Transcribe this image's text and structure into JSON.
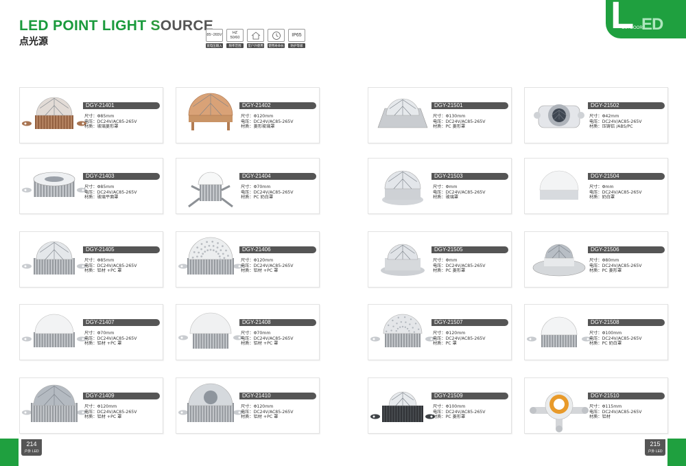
{
  "header": {
    "title_colored": [
      {
        "text": "LED POINT LIGHT ",
        "color": "#1a9a3c"
      },
      {
        "text": "S",
        "color": "#2c9a3e"
      },
      {
        "text": "OURCE",
        "color": "#555555"
      }
    ],
    "subtitle": "点光源",
    "specs": [
      {
        "lines": [
          "85~265V"
        ],
        "caption": "宽电压输入",
        "icon": "voltage-icon"
      },
      {
        "lines": [
          "HZ",
          "50/60"
        ],
        "caption": "频率范围",
        "icon": "frequency-icon"
      },
      {
        "lines": [
          ""
        ],
        "caption": "室户外使用",
        "icon": "house-icon"
      },
      {
        "lines": [
          ""
        ],
        "caption": "使用寿命长",
        "icon": "clock-icon"
      },
      {
        "lines": [
          "IP65"
        ],
        "caption": "防护等级",
        "icon": "ip-icon"
      }
    ]
  },
  "corner": {
    "big": "L",
    "ed": "ED",
    "tag": "OUTDOOR"
  },
  "labels": {
    "size": "尺寸：",
    "voltage": "电压：",
    "material": "材质："
  },
  "products": [
    {
      "model": "DGY-21401",
      "size": "Φ85mm",
      "voltage": "DC24V/AC85-265V",
      "material": "玻璃菱形罩",
      "lamp": "crystal-copper"
    },
    {
      "model": "DGY-21402",
      "size": "Φ120mm",
      "voltage": "DC24V/AC85-265V",
      "material": "菱形玻璃罩",
      "lamp": "gold"
    },
    {
      "model": "DGY-21501",
      "size": "Φ130mm",
      "voltage": "DC24V/AC85-265V",
      "material": "PC 菱形罩",
      "lamp": "hex-silver"
    },
    {
      "model": "DGY-21502",
      "size": "Φ42mm",
      "voltage": "DC24V/AC85-265V",
      "material": "压铸铝 /ABS/PC",
      "lamp": "small-crystal"
    },
    {
      "model": "DGY-21403",
      "size": "Φ85mm",
      "voltage": "DC24V/AC85-265V",
      "material": "玻璃平面罩",
      "lamp": "flat-white"
    },
    {
      "model": "DGY-21404",
      "size": "Φ70mm",
      "voltage": "DC24V/AC85-265V",
      "material": "PC 奶白罩",
      "lamp": "milk-legs"
    },
    {
      "model": "DGY-21503",
      "size": "Φmm",
      "voltage": "DC24V/AC85-265V",
      "material": "玻璃罩",
      "lamp": "round-glass"
    },
    {
      "model": "DGY-21504",
      "size": "Φmm",
      "voltage": "DC24V/AC85-265V",
      "material": "奶白罩",
      "lamp": "milk-round"
    },
    {
      "model": "DGY-21405",
      "size": "Φ85mm",
      "voltage": "DC24V/AC85-265V",
      "material": "铝材 +PC 罩",
      "lamp": "crystal-fin"
    },
    {
      "model": "DGY-21406",
      "size": "Φ120mm",
      "voltage": "DC24V/AC85-265V",
      "material": "铝材 +PC 罩",
      "lamp": "dot-fin"
    },
    {
      "model": "DGY-21505",
      "size": "Φmm",
      "voltage": "DC24V/AC85-265V",
      "material": "PC 菱形罩",
      "lamp": "crystal-base"
    },
    {
      "model": "DGY-21506",
      "size": "Φ80mm",
      "voltage": "DC24V/AC85-265V",
      "material": "PC 菱形罩",
      "lamp": "crystal-plate"
    },
    {
      "model": "DGY-21407",
      "size": "Φ70mm",
      "voltage": "DC24V/AC85-265V",
      "material": "铝材 +PC 罩",
      "lamp": "milk-fin"
    },
    {
      "model": "DGY-21408",
      "size": "Φ70mm",
      "voltage": "DC24V/AC85-265V",
      "material": "铝材 +PC 罩",
      "lamp": "milk-fin-lg"
    },
    {
      "model": "DGY-21507",
      "size": "Φ120mm",
      "voltage": "DC24V/AC85-265V",
      "material": "PC 罩",
      "lamp": "clear-fin"
    },
    {
      "model": "DGY-21508",
      "size": "Φ100mm",
      "voltage": "DC24V/AC85-265V",
      "material": "PC 奶白罩",
      "lamp": "milk-fin-sm"
    },
    {
      "model": "DGY-21409",
      "size": "Φ120mm",
      "voltage": "DC24V/AC85-265V",
      "material": "铝材 +PC 罩",
      "lamp": "crystal-fin-lg"
    },
    {
      "model": "DGY-21410",
      "size": "Φ120mm",
      "voltage": "DC24V/AC85-265V",
      "material": "铝材 +PC 罩",
      "lamp": "clear-fin-lg"
    },
    {
      "model": "DGY-21509",
      "size": "Φ100mm",
      "voltage": "DC24V/AC85-265V",
      "material": "PC 菱形罩",
      "lamp": "dark-fin"
    },
    {
      "model": "DGY-21510",
      "size": "Φ115mm",
      "voltage": "DC24V/AC85-265V",
      "material": "铝材",
      "lamp": "cross-orange"
    }
  ],
  "footer": {
    "left": {
      "num": "214",
      "caption": "户外 LED"
    },
    "right": {
      "num": "215",
      "caption": "户外 LED"
    }
  },
  "colors": {
    "brand_green": "#1fa03f",
    "label_gray": "#555555"
  }
}
